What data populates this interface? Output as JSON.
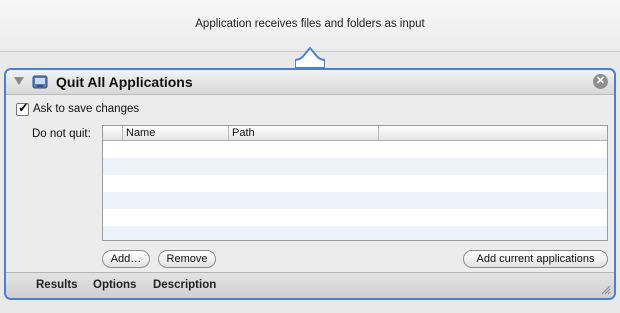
{
  "input_banner": {
    "text": "Application receives files and folders as input"
  },
  "action": {
    "title": "Quit All Applications",
    "ask_to_save": {
      "label": "Ask to save changes",
      "checked": true
    },
    "do_not_quit_label": "Do not quit:",
    "table": {
      "columns": [
        "Name",
        "Path"
      ],
      "rows": []
    },
    "buttons": {
      "add": "Add…",
      "remove": "Remove",
      "add_current": "Add current applications"
    },
    "footer_tabs": [
      "Results",
      "Options",
      "Description"
    ],
    "close_symbol": "✕"
  },
  "colors": {
    "selection_border": "#4a7fd8",
    "alt_row": "#eef3fb"
  },
  "icons": {
    "disclosure": "disclosure-triangle-icon",
    "app": "automator-app-icon",
    "close": "close-circle-icon",
    "resize": "resize-grip-icon"
  }
}
